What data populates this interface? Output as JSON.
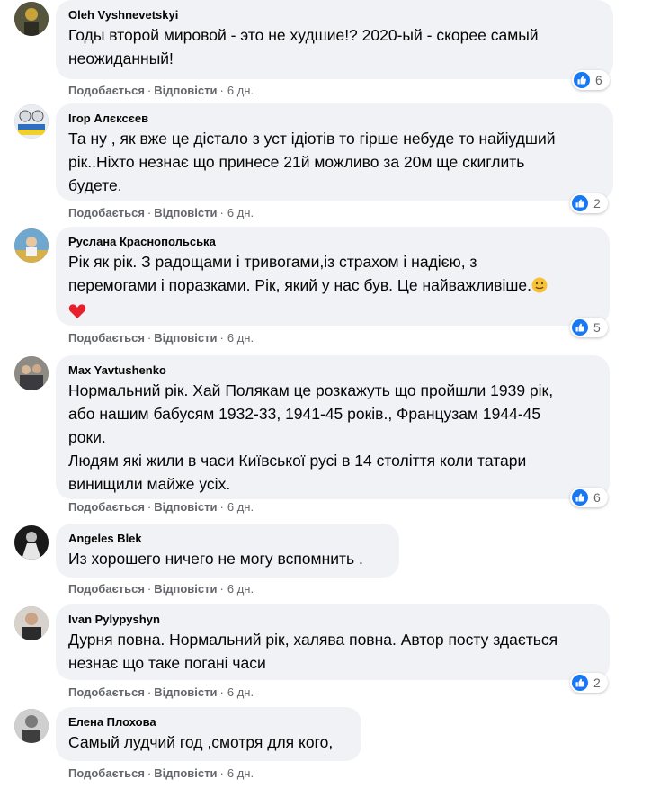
{
  "colors": {
    "bubble": "#f0f2f5",
    "like": "#1877f2",
    "meta": "#65676b"
  },
  "action_labels": {
    "like": "Подобається",
    "reply": "Відповісти",
    "separator": "·"
  },
  "comments": [
    {
      "author": "Oleh Vyshnevetskyi",
      "lines": [
        "Годы второй мировой - это не худшие!? 2020-ый - скорее самый",
        "неожиданный!"
      ],
      "time": "6 дн.",
      "reactions": "6",
      "reaction_icon": "like-icon"
    },
    {
      "author": "Ігор Алєксєев",
      "lines": [
        "Та ну , як вже це дістало з уст ідіотів то гірше небуде то найіудший",
        "рік..Ніхто незнає що принесе 21й можливо за 20м ще скиглить",
        "будете."
      ],
      "time": "6 дн.",
      "reactions": "2",
      "reaction_icon": "like-icon"
    },
    {
      "author": "Руслана Краснопольська",
      "lines": [
        "Рік як рік. З радощами і тривогами,із страхом і надією, з",
        "перемогами і поразками. Рік, який у нас був. Це найважливіше."
      ],
      "emoji": [
        "smiling-face-emoji",
        "red-heart-emoji"
      ],
      "time": "6 дн.",
      "reactions": "5",
      "reaction_icon": "like-icon"
    },
    {
      "author": "Max Yavtushenko",
      "lines": [
        "Нормальний рік. Хай Полякам це розкажуть що пройшли 1939 рік,",
        "або нашим бабусям 1932-33, 1941-45 років., Французам 1944-45",
        "роки.",
        "Людям які жили в часи Київської русі в 14 століття коли татари",
        "винищили майже усіх."
      ],
      "time": "6 дн.",
      "reactions": "6",
      "reaction_icon": "like-icon"
    },
    {
      "author": "Angeles Blek",
      "lines": [
        "Из хорошего ничего не могу вспомнить ."
      ],
      "time": "6 дн."
    },
    {
      "author": "Ivan Pylypyshyn",
      "lines": [
        "Дурня повна. Нормальний рік, халява повна. Автор посту здається",
        "незнає що таке погані часи"
      ],
      "time": "6 дн.",
      "reactions": "2",
      "reaction_icon": "like-icon"
    },
    {
      "author": "Елена Плохова",
      "lines": [
        "Самый лудчий год ,смотря для кого,"
      ],
      "time": "6 дн."
    }
  ]
}
